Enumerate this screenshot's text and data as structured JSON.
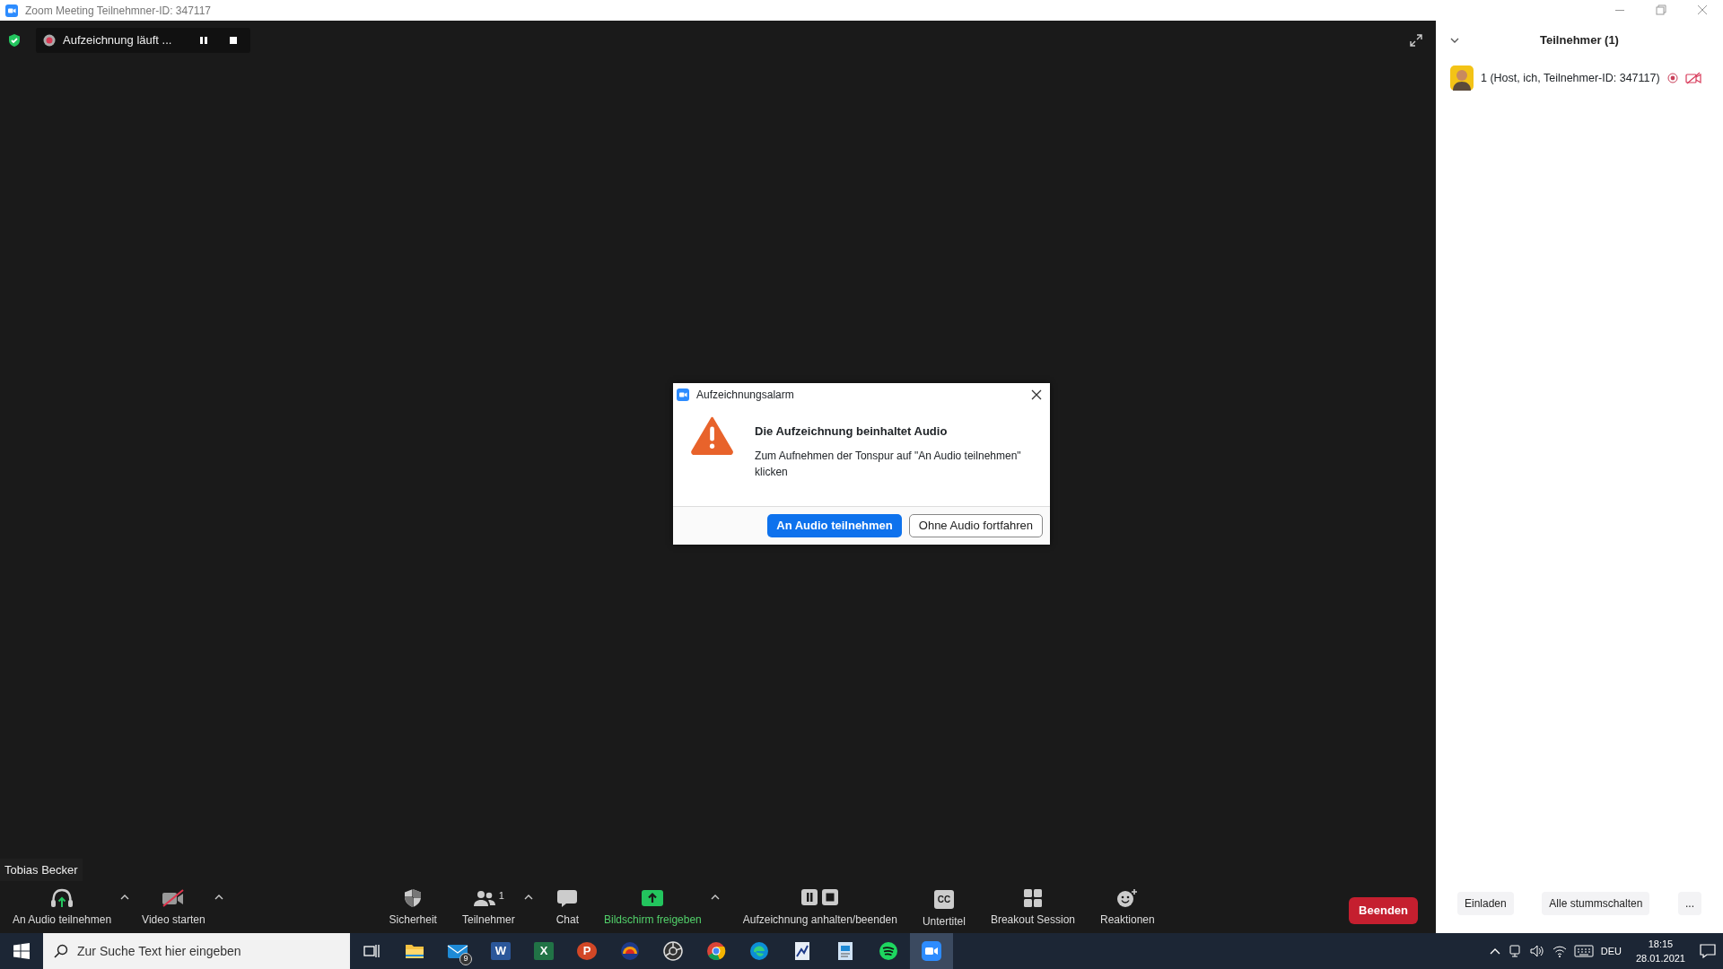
{
  "window": {
    "title": "Zoom Meeting Teilnehmner-ID: 347117"
  },
  "recording": {
    "label": "Aufzeichnung läuft ..."
  },
  "video": {
    "name_tag": "Tobias Becker"
  },
  "dialog": {
    "title": "Aufzeichnungsalarm",
    "heading": "Die Aufzeichnung beinhaltet Audio",
    "message": "Zum Aufnehmen der Tonspur auf \"An Audio teilnehmen\" klicken",
    "buttons": [
      {
        "label": "An Audio teilnehmen",
        "primary": true
      },
      {
        "label": "Ohne Audio fortfahren",
        "primary": false
      }
    ]
  },
  "toolbar": {
    "left": [
      {
        "kind": "audio",
        "label": "An Audio teilnehmen",
        "caret": true
      },
      {
        "kind": "video",
        "label": "Video starten",
        "caret": true
      }
    ],
    "center": [
      {
        "kind": "security",
        "label": "Sicherheit",
        "caret": false
      },
      {
        "kind": "participants",
        "label": "Teilnehmer",
        "badge": "1",
        "caret": true
      },
      {
        "kind": "chat",
        "label": "Chat",
        "caret": false
      },
      {
        "kind": "share",
        "label": "Bildschirm freigeben",
        "caret": true
      },
      {
        "kind": "record",
        "label": "Aufzeichnung anhalten/beenden",
        "caret": false
      },
      {
        "kind": "cc",
        "label": "Untertitel",
        "icon_text": "CC",
        "caret": false
      },
      {
        "kind": "breakout",
        "label": "Breakout Session",
        "caret": false
      },
      {
        "kind": "reactions",
        "label": "Reaktionen",
        "caret": false
      }
    ],
    "end_button": "Beenden"
  },
  "panel": {
    "title": "Teilnehmer (1)",
    "participants": [
      {
        "name": "1 (Host, ich, Teilnehmer-ID: 347117)",
        "recording": true,
        "video_off": true
      }
    ],
    "buttons": [
      "Einladen",
      "Alle stummschalten",
      "..."
    ]
  },
  "taskbar": {
    "search": {
      "placeholder": "Zur Suche Text hier eingeben"
    },
    "apps": [
      {
        "kind": "folder",
        "selected": false
      },
      {
        "kind": "mail",
        "badge": "9",
        "selected": false
      },
      {
        "kind": "tile",
        "label": "W",
        "color": "#2b579a",
        "selected": false
      },
      {
        "kind": "tile",
        "label": "X",
        "color": "#217346",
        "selected": false
      },
      {
        "kind": "round",
        "label": "P",
        "color": "#d24726",
        "selected": false
      },
      {
        "kind": "arc",
        "selected": false
      },
      {
        "kind": "aperture",
        "selected": false
      },
      {
        "kind": "chrome",
        "selected": false
      },
      {
        "kind": "edge",
        "selected": false
      },
      {
        "kind": "chart",
        "selected": false
      },
      {
        "kind": "doc",
        "selected": false
      },
      {
        "kind": "spotify",
        "selected": false
      },
      {
        "kind": "camera",
        "selected": true
      }
    ],
    "language": "DEU",
    "time": "18:15",
    "date": "28.01.2021"
  }
}
